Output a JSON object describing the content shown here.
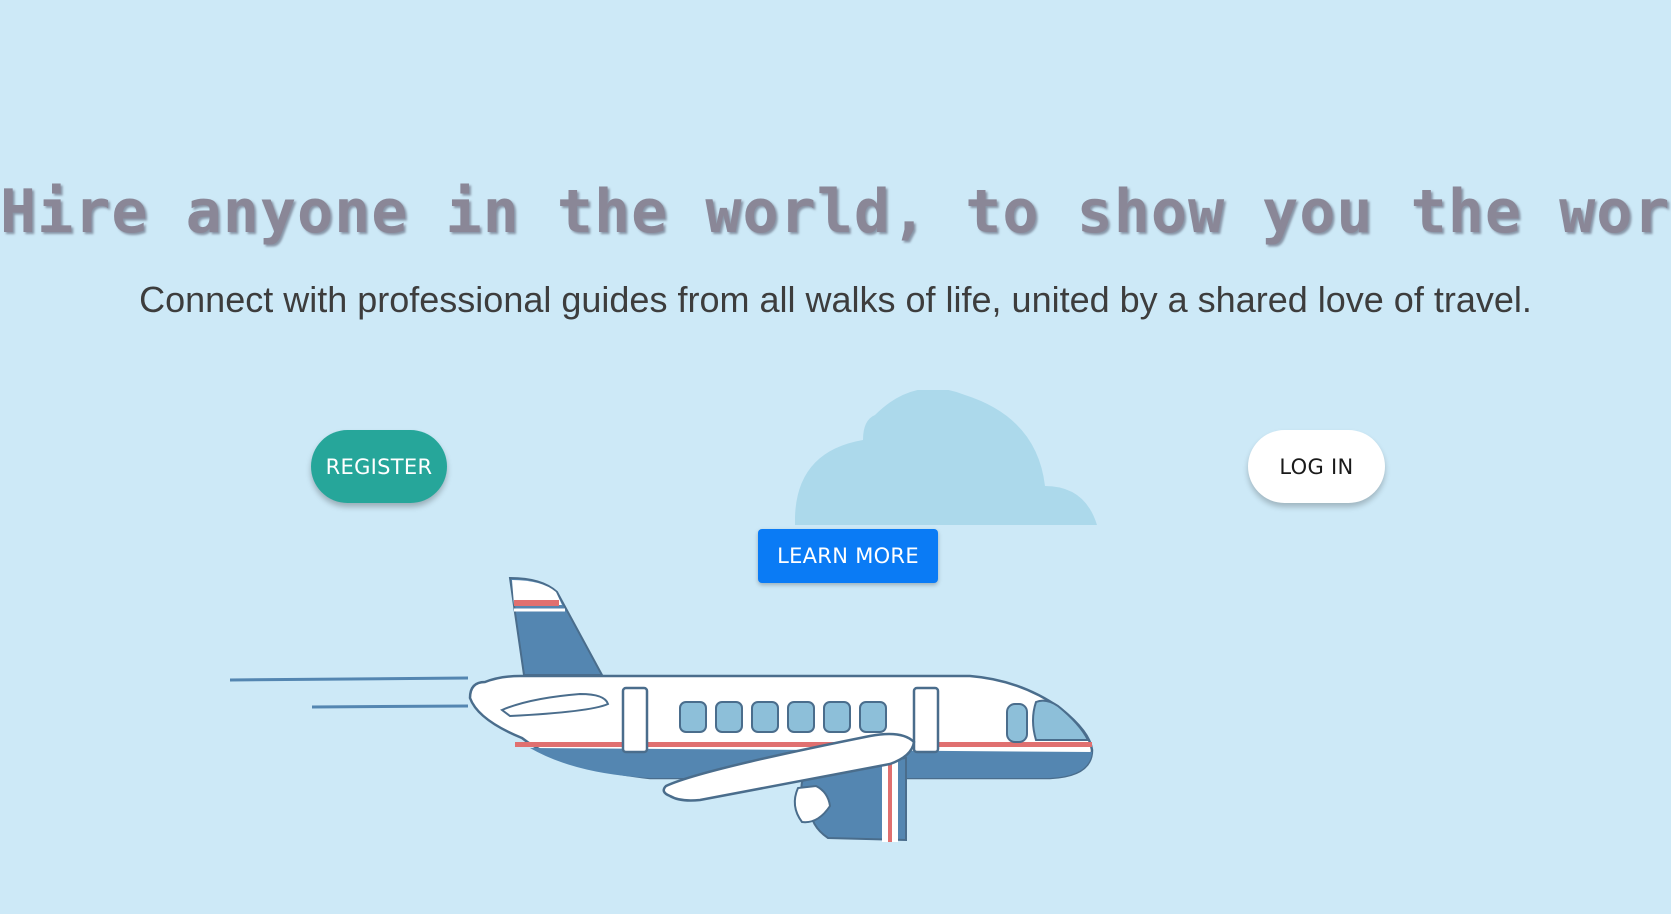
{
  "hero": {
    "headline": "Hire anyone in the world, to show you the world.",
    "subheadline": "Connect with professional guides from all walks of life, united by a shared love of travel."
  },
  "buttons": {
    "register_label": "REGISTER",
    "login_label": "LOG IN",
    "learn_more_label": "LEARN MORE"
  },
  "illustrations": {
    "cloud_icon": "cloud-icon",
    "plane_icon": "airplane-icon"
  },
  "colors": {
    "background": "#cde9f7",
    "headline": "#8a8797",
    "subheadline": "#3d3d3d",
    "register_button": "#26a69a",
    "login_button": "#ffffff",
    "learn_more_button": "#0a7bf5",
    "cloud": "#acd9eb",
    "plane_blue": "#5486b1",
    "plane_red": "#e07070",
    "plane_window": "#8dbfd9"
  }
}
